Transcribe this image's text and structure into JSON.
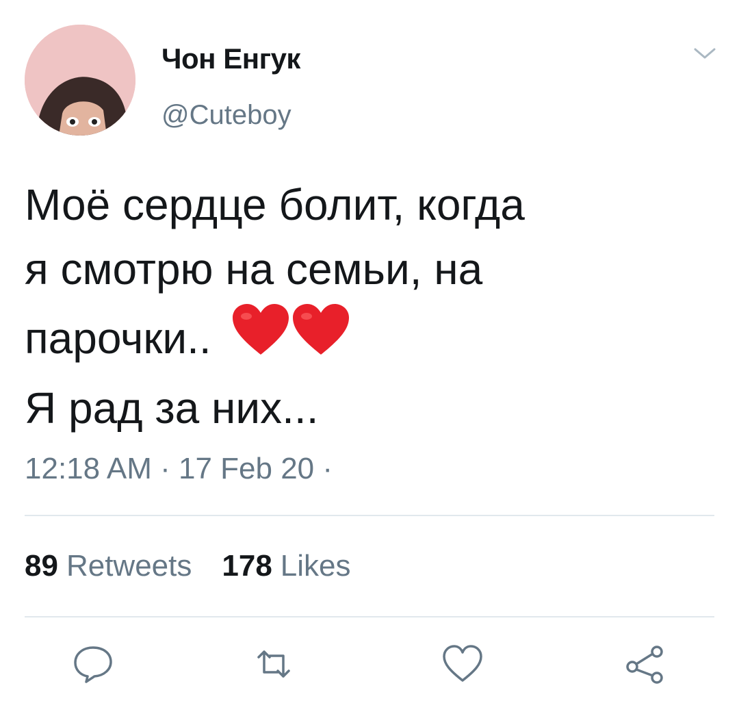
{
  "author": {
    "name": "Чон Енгук",
    "handle": "@Cuteboy"
  },
  "tweet": {
    "text": "Моё сердце болит, когда\nя смотрю на семьи, на\nпарочки.. ",
    "emoji": "❤️❤️",
    "text_after": "\nЯ рад за них...",
    "timestamp": "12:18 AM · 17 Feb 20 ·"
  },
  "stats": {
    "retweets_count": "89",
    "retweets_label": "Retweets",
    "likes_count": "178",
    "likes_label": "Likes"
  },
  "colors": {
    "text": "#14171a",
    "secondary": "#657786",
    "divider": "#e1e8ed",
    "heart": "#e8202a"
  },
  "icons": [
    "reply-icon",
    "retweet-icon",
    "like-icon",
    "share-icon",
    "chevron-down-icon"
  ]
}
